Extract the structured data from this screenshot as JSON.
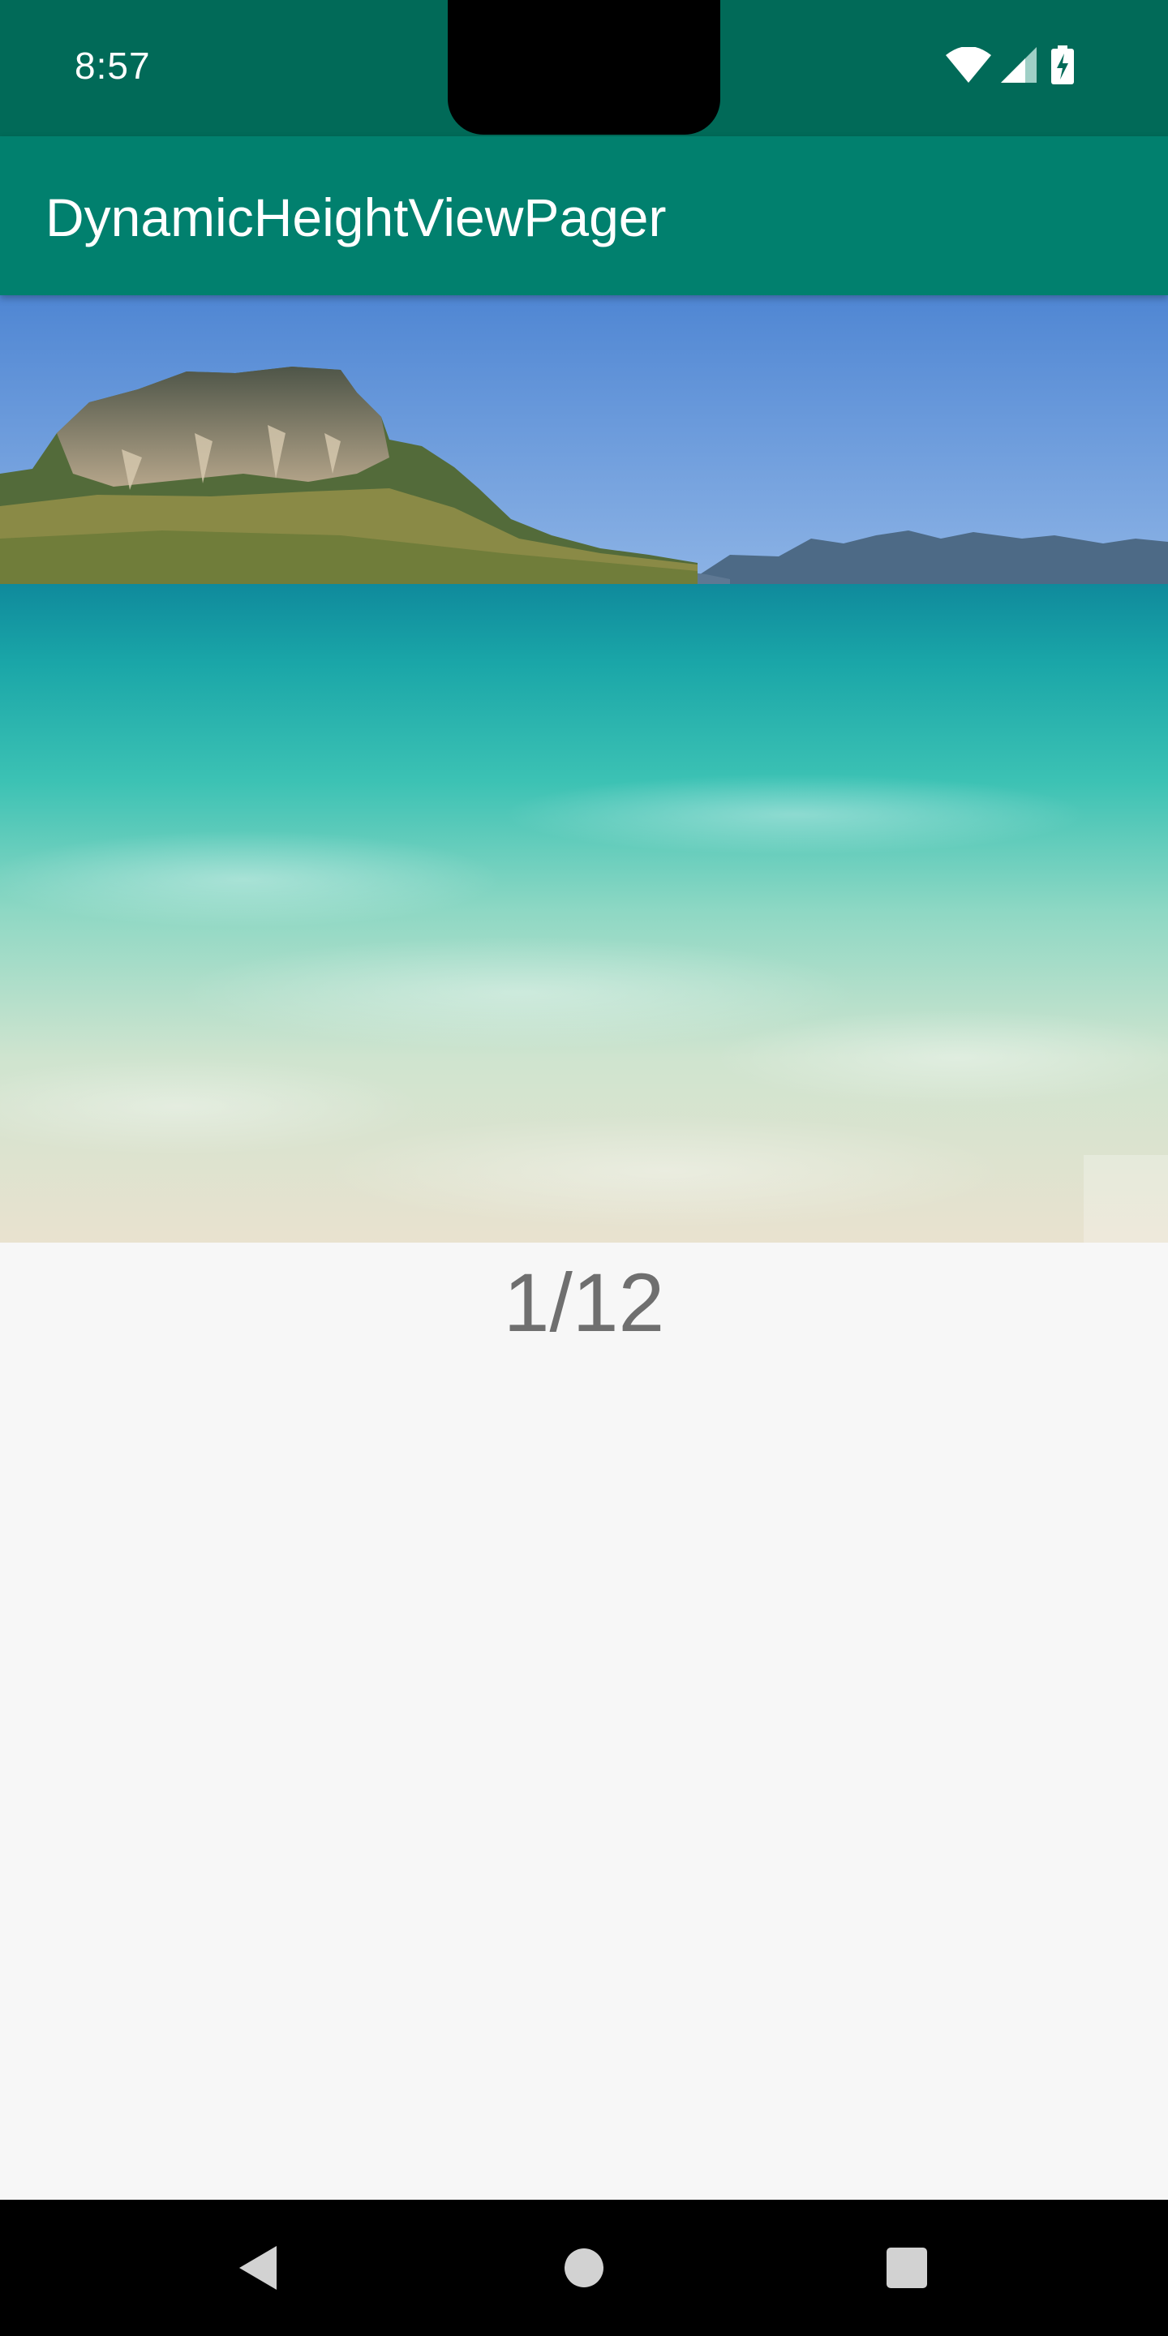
{
  "status_bar": {
    "time": "8:57",
    "icons": [
      "wifi-icon",
      "cellular-signal-icon",
      "battery-charging-icon"
    ],
    "background": "#016a58"
  },
  "app_bar": {
    "title": "DynamicHeightViewPager",
    "background": "#01806e"
  },
  "pager": {
    "image_description": "beach-photo",
    "counter": "1/12"
  },
  "nav_bar": {
    "buttons": [
      "back-icon",
      "home-icon",
      "recents-icon"
    ]
  }
}
